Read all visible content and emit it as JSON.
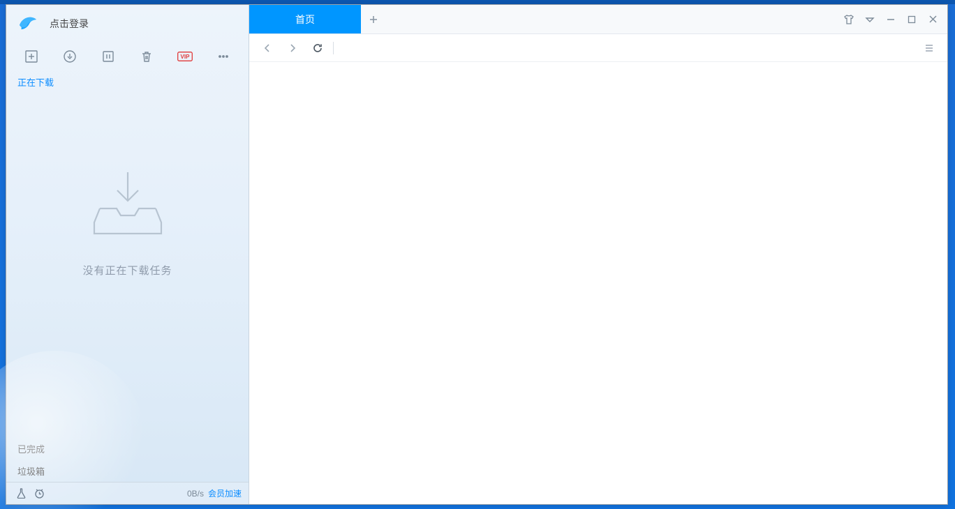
{
  "login": {
    "label": "点击登录"
  },
  "sidebar": {
    "categories": {
      "downloading": "正在下载",
      "completed": "已完成",
      "trash": "垃圾箱"
    },
    "empty_message": "没有正在下载任务"
  },
  "toolbar_icons": {
    "new_task": "new-task",
    "start": "start",
    "pause": "pause",
    "delete": "delete",
    "vip": "VIP",
    "more": "more"
  },
  "status": {
    "speed": "0B/s",
    "vip_link": "会员加速"
  },
  "tabs": {
    "home": "首页"
  },
  "window_controls": {
    "skin": "skin",
    "dropdown": "dropdown",
    "minimize": "minimize",
    "maximize": "maximize",
    "close": "close"
  }
}
